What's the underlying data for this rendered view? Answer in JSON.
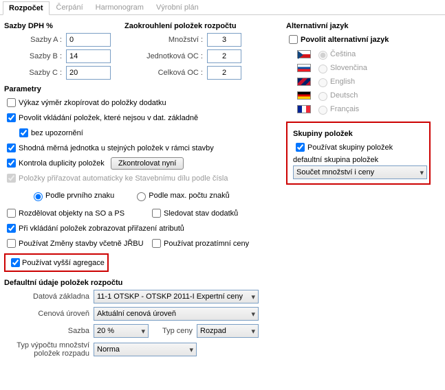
{
  "tabs": {
    "rozpocet": "Rozpočet",
    "cerpani": "Čerpání",
    "harmonogram": "Harmonogram",
    "vyrobni_plan": "Výrobní plán"
  },
  "sazby": {
    "title": "Sazby DPH %",
    "a_label": "Sazby A :",
    "a_value": "0",
    "b_label": "Sazby B :",
    "b_value": "14",
    "c_label": "Sazby C :",
    "c_value": "20"
  },
  "round": {
    "title": "Zaokrouhlení položek rozpočtu",
    "mnozstvi_label": "Množství :",
    "mnozstvi_value": "3",
    "jednotkova_label": "Jednotková OC :",
    "jednotkova_value": "2",
    "celkova_label": "Celková OC :",
    "celkova_value": "2"
  },
  "params": {
    "title": "Parametry",
    "vykaz": "Výkaz výměr zkopírovat do položky dodatku",
    "povolit_vkladani": "Povolit vkládání položek, které nejsou v dat. základně",
    "bez_upozorneni": "bez upozornění",
    "shodna": "Shodná měrná jednotka u stejných položek v rámci stavby",
    "kontrola": "Kontrola duplicity položek",
    "zkontrolovat": "Zkontrolovat nyní",
    "prirazovat": "Položky přiřazovat automaticky ke Stavebnímu dílu  podle čísla",
    "podle_prvniho": "Podle prvního znaku",
    "podle_max": "Podle max. počtu znaků",
    "rozdelovat": "Rozdělovat objekty na SO a PS",
    "sledovat": "Sledovat stav dodatků",
    "pri_vkladani": "Při vkládání položek zobrazovat přiřazení atributů",
    "zmeny": "Používat Změny stavby včetně JŘBU",
    "prozatimni": "Používat prozatímní ceny",
    "vyssi": "Používat vyšší agregace"
  },
  "defaults": {
    "title": "Defaultní údaje položek rozpočtu",
    "datova_label": "Datová základna",
    "datova_value": "11-1 OTSKP  -  OTSKP 2011-I Expertní ceny",
    "cenova_label": "Cenová úroveň",
    "cenova_value": "Aktuální cenová úroveň",
    "sazba_label": "Sazba",
    "sazba_value": "20 %",
    "typ_ceny_label": "Typ ceny",
    "typ_ceny_value": "Rozpad",
    "typ_vypoctu_label": "Typ výpočtu množství položek rozpadu",
    "typ_vypoctu_value": "Norma"
  },
  "lang": {
    "title": "Alternativní jazyk",
    "povolit": "Povolit alternativní jazyk",
    "cz": "Čeština",
    "sk": "Slovenčina",
    "en": "English",
    "de": "Deutsch",
    "fr": "Français"
  },
  "groups": {
    "title": "Skupiny položek",
    "pouzivat": "Používat skupiny položek",
    "default_label": "defaultní skupina položek",
    "default_value": "Součet množství i ceny"
  }
}
